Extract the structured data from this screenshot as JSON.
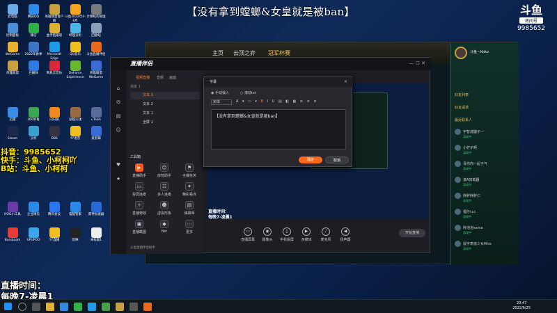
{
  "banner": "【没有拿到螳螂&女皇就是被ban】",
  "logo": {
    "mark": "斗鱼",
    "sub": "房间号",
    "room_id": "9985652"
  },
  "overlays": {
    "douyu": "抖音：9985652",
    "kuaishou": "快手：斗鱼、小柯柯吖",
    "bilibili": "B站：斗鱼、小柯柯",
    "live_time": "直播时间：",
    "live_hours": "每晚7-凌晨1",
    "small_time": "直播时间：",
    "small_hours": "每晚7-凌晨1"
  },
  "desktop_icons": [
    {
      "label": "此电脑",
      "color": "#6aa8e8"
    },
    {
      "label": "腾讯QQ",
      "color": "#2e8ae6"
    },
    {
      "label": "英雄联盟客户端",
      "color": "#c8a040"
    },
    {
      "label": "斗鱼2022年4-6月",
      "color": "#f6a623"
    },
    {
      "label": "计算机的管理",
      "color": "#7a7a7a"
    },
    {
      "label": "控制面板",
      "color": "#4a90d9"
    },
    {
      "label": "微信",
      "color": "#2fb14a"
    },
    {
      "label": "金手指兼容",
      "color": "#e0b030"
    },
    {
      "label": "哔哩分析",
      "color": "#4ab6e8"
    },
    {
      "label": "回收站",
      "color": "#8aa0b8"
    },
    {
      "label": "WeGame",
      "color": "#e8b030"
    },
    {
      "label": "2022年春季",
      "color": "#3f73c6"
    },
    {
      "label": "Microsoft Edge",
      "color": "#1e9be8"
    },
    {
      "label": "QQ音乐",
      "color": "#f0c020"
    },
    {
      "label": "斗鱼直播伴侣",
      "color": "#e86a1a"
    },
    {
      "label": "英雄联盟",
      "color": "#c8a040"
    },
    {
      "label": "已删除",
      "color": "#2f7be0"
    },
    {
      "label": "网易云音乐",
      "color": "#d8283a"
    },
    {
      "label": "GeForce Experience",
      "color": "#6ab82a"
    },
    {
      "label": "英雄联盟WeGame",
      "color": "#3a6cd8"
    },
    {
      "label": "迅雷",
      "color": "#3a8ae8"
    },
    {
      "label": "360杀毒",
      "color": "#3aa850"
    },
    {
      "label": "向日葵",
      "color": "#f08a20"
    },
    {
      "label": "穿越火线",
      "color": "#9a6a40"
    },
    {
      "label": "uTools",
      "color": "#5a6a9a"
    },
    {
      "label": "Steam",
      "color": "#1b2a4a"
    },
    {
      "label": "分析",
      "color": "#3aa0d0"
    },
    {
      "label": "OBS",
      "color": "#333344"
    },
    {
      "label": "YY语音",
      "color": "#f0c020"
    },
    {
      "label": "爱剪辑",
      "color": "#3a6ad8"
    },
    {
      "label": "ROG小工具",
      "color": "#6a3aa8"
    },
    {
      "label": "企业微信",
      "color": "#2a8ae8"
    },
    {
      "label": "腾讯会议",
      "color": "#2a78f0"
    },
    {
      "label": "电脑管家",
      "color": "#2a88e8"
    },
    {
      "label": "雷神加速器",
      "color": "#2a6ad8"
    },
    {
      "label": "Bandicam",
      "color": "#e83a3a"
    },
    {
      "label": "UPUPOO",
      "color": "#3aa8e8"
    },
    {
      "label": "YY直播",
      "color": "#f0c020"
    },
    {
      "label": "剪映",
      "color": "#222222"
    },
    {
      "label": "未标题1",
      "color": "#eeeeee"
    }
  ],
  "game_client": {
    "tabs": [
      "主页",
      "云顶之弈",
      "冠军杯赛"
    ],
    "player_name": "斗鱼丶Koko",
    "sections": [
      "好友列表",
      "好友请求",
      "最近联系人"
    ],
    "friends": [
      "宇智波鼬子一",
      "小柠子啊",
      "青你你一起子气",
      "滚A加载器",
      "胖胖胖胖仁",
      "福仔ccc",
      "胖泡泡sama",
      "鼠宇表兽少女Miss"
    ],
    "status": "游戏中"
  },
  "obs": {
    "app_title": "直播伴侣",
    "left_tabs": [
      "视频直播",
      "音频",
      "画面"
    ],
    "scene_label": "场景 1",
    "layers": [
      "文本 3",
      "文本 2",
      "文本 1",
      "全屏 1"
    ],
    "tools_title": "工具箱",
    "tools": [
      "直播助手",
      "房管助手",
      "主播任务",
      "投屏连麦",
      "多人连麦",
      "精彩看点",
      "直播特效",
      "虚拟形象",
      "弹幕库",
      "直播截图",
      "Bet",
      "更多"
    ],
    "bottom_tools": [
      "直播屏幕",
      "摄像头",
      "手机投屏",
      "多媒体",
      "麦克风",
      "扬声器"
    ],
    "start_label": "开始直播",
    "footer": "斗鱼直播伴侣助手"
  },
  "dialog": {
    "title": "字幕",
    "mode1": "手动输入",
    "mode2": "滚动txt",
    "font": "宋体",
    "text": "【没有拿到螳螂&女皇就是被ban】",
    "confirm": "确定",
    "cancel": "取消"
  },
  "clock": {
    "time": "20:47",
    "date": "2022/6/25"
  }
}
